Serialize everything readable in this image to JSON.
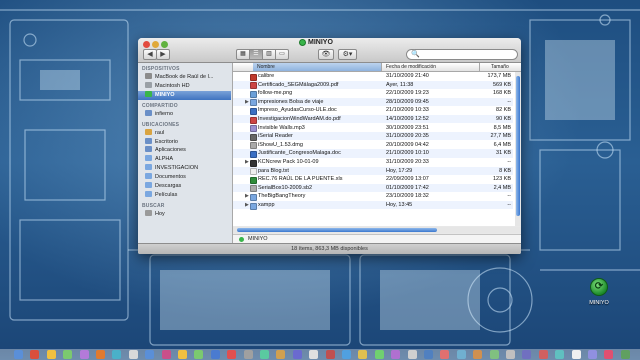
{
  "window": {
    "title": "MINIYO",
    "back_label": "◀",
    "forward_label": "▶",
    "view_icons": [
      "icon-view-icon",
      "list-view-icon",
      "column-view-icon",
      "coverflow-view-icon"
    ],
    "eye_label": "👁",
    "gear_label": "⚙▾",
    "search_placeholder": "",
    "search_glyph": "🔍"
  },
  "sidebar": {
    "headings": {
      "devices": "DISPOSITIVOS",
      "shared": "COMPARTIDO",
      "places": "UBICACIONES",
      "search": "BUSCAR"
    },
    "devices": [
      {
        "label": "MacBook de Raúl de l...",
        "color": "#8c8c8c"
      },
      {
        "label": "Macintosh HD",
        "color": "#9aa0a6"
      },
      {
        "label": "MINIYO",
        "color": "#39b54a"
      }
    ],
    "shared": [
      {
        "label": "infierno",
        "color": "#6a8fc7"
      }
    ],
    "places": [
      {
        "label": "raul",
        "color": "#d9a441"
      },
      {
        "label": "Escritorio",
        "color": "#6a8fc7"
      },
      {
        "label": "Aplicaciones",
        "color": "#6a8fc7"
      },
      {
        "label": "ALPHA",
        "color": "#7aa7e0"
      },
      {
        "label": "INVESTIGACION",
        "color": "#7aa7e0"
      },
      {
        "label": "Documentos",
        "color": "#7aa7e0"
      },
      {
        "label": "Descargas",
        "color": "#7aa7e0"
      },
      {
        "label": "Películas",
        "color": "#7aa7e0"
      }
    ],
    "search": [
      {
        "label": "Hoy",
        "color": "#9a9a9a"
      }
    ]
  },
  "columns": {
    "name": "Nombre",
    "date": "Fecha de modificación",
    "size": "Tamaño"
  },
  "files": [
    {
      "name": "calibre",
      "date": "31/10/2009 21:40",
      "size": "173,7 MB",
      "kind": "app",
      "color": "#c0392b",
      "folder": false
    },
    {
      "name": "Certificado_SEGMálaga2009.pdf",
      "date": "Ayer, 11:38",
      "size": "569 KB",
      "kind": "pdf",
      "color": "#c44",
      "folder": false
    },
    {
      "name": "follow-me.png",
      "date": "22/10/2009 19:23",
      "size": "168 KB",
      "kind": "image",
      "color": "#6a9fd8",
      "folder": false
    },
    {
      "name": "impresiones Bolsa de viaje",
      "date": "28/10/2009 09:45",
      "size": "--",
      "kind": "folder",
      "color": "#7aa7e0",
      "folder": true
    },
    {
      "name": "Impreso_AyudasCurso-ULE.doc",
      "date": "21/10/2009 10:33",
      "size": "82 KB",
      "kind": "doc",
      "color": "#3a6fc4",
      "folder": false
    },
    {
      "name": "InvestigacionWindWardAM.do.pdf",
      "date": "14/10/2009 12:52",
      "size": "90 KB",
      "kind": "pdf",
      "color": "#c44",
      "folder": false
    },
    {
      "name": "Invisible Walls.mp3",
      "date": "30/10/2009 23:51",
      "size": "8,5 MB",
      "kind": "audio",
      "color": "#9a8fd0",
      "folder": false
    },
    {
      "name": "iSerial Reader",
      "date": "31/10/2009 20:35",
      "size": "27,7 MB",
      "kind": "app",
      "color": "#666",
      "folder": false
    },
    {
      "name": "iShowU_1.53.dmg",
      "date": "20/10/2009 04:42",
      "size": "6,4 MB",
      "kind": "dmg",
      "color": "#aaa",
      "folder": false
    },
    {
      "name": "Justificante_CongresoMalaga.doc",
      "date": "21/10/2009 10:10",
      "size": "31 KB",
      "kind": "doc",
      "color": "#3a6fc4",
      "folder": false
    },
    {
      "name": "KCNcrew Pack 10-01-09",
      "date": "31/10/2009 20:33",
      "size": "--",
      "kind": "folder",
      "color": "#333",
      "folder": true
    },
    {
      "name": "para Blog.txt",
      "date": "Hoy, 17:29",
      "size": "8 KB",
      "kind": "text",
      "color": "#eee",
      "folder": false
    },
    {
      "name": "REC.76 RAÚL DE LA PUENTE.xls",
      "date": "22/09/2009 13:07",
      "size": "123 KB",
      "kind": "xls",
      "color": "#2e8b3a",
      "folder": false
    },
    {
      "name": "SerialBox10-2009.sb2",
      "date": "01/10/2009 17:42",
      "size": "2,4 MB",
      "kind": "file",
      "color": "#aaa",
      "folder": false
    },
    {
      "name": "TheBigBangTheory",
      "date": "23/10/2009 18:32",
      "size": "--",
      "kind": "folder",
      "color": "#7aa7e0",
      "folder": true
    },
    {
      "name": "xampp",
      "date": "Hoy, 13:45",
      "size": "--",
      "kind": "folder",
      "color": "#7aa7e0",
      "folder": true
    }
  ],
  "pathbar": {
    "label": "MINIYO"
  },
  "status": {
    "text": "18 ítems, 863,3 MB disponibles"
  },
  "desktop_icon": {
    "label": "MINIYO",
    "glyph": "⟳"
  },
  "dock_colors": [
    "#5a8fd8",
    "#d94f3d",
    "#f0c040",
    "#7bc96f",
    "#b37ad9",
    "#e07a2f",
    "#4ab0c9",
    "#d9d9d9",
    "#5a8fd8",
    "#c94f8a",
    "#f0c040",
    "#7bc96f",
    "#4a7bd0",
    "#e05050",
    "#a0a0a0",
    "#5ac9a0",
    "#d0a050",
    "#6a6ad0",
    "#e0e0e0",
    "#c05050",
    "#50a0e0",
    "#e0c050",
    "#70d070",
    "#b070d0",
    "#d0d0d0",
    "#5080c0",
    "#e07070",
    "#70b0d0",
    "#d09050",
    "#80c080",
    "#c0c0c0",
    "#7070c0",
    "#d06060",
    "#60c0c0",
    "#f0f0f0",
    "#9090e0",
    "#e05070",
    "#60a060"
  ]
}
